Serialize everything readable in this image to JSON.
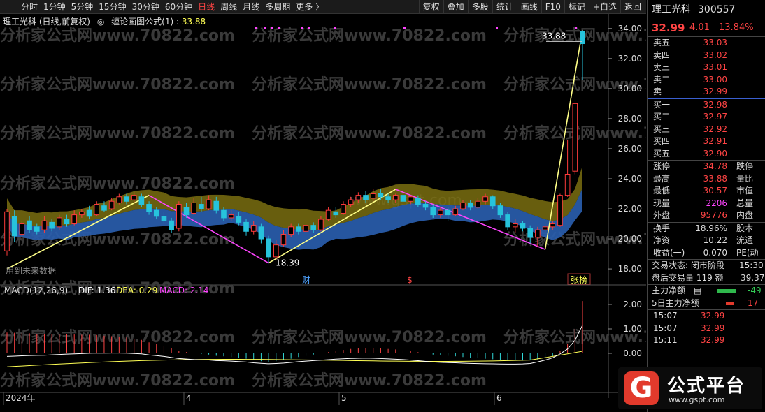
{
  "toolbar": {
    "periods": [
      "分时",
      "1分钟",
      "5分钟",
      "15分钟",
      "30分钟",
      "60分钟",
      "日线",
      "周线",
      "月线",
      "多周期",
      "更多 〉"
    ],
    "active_period": "日线",
    "tools": [
      "复权",
      "叠加",
      "多股",
      "统计",
      "画线",
      "F10",
      "标记",
      "+自选",
      "返回"
    ]
  },
  "main_chart": {
    "title": "理工光科 (日线,前复权)",
    "indicator_name": "缠论画图公式(1) :",
    "indicator_value": "33.88",
    "y_ticks": [
      "34.00",
      "32.00",
      "30.00",
      "28.00",
      "26.00",
      "24.00",
      "22.00",
      "20.00",
      "18.00"
    ],
    "high_label": "33.88",
    "low_label": "18.39",
    "future_label": "用到未来数据",
    "event_labels": [
      "财",
      "$",
      "张榜"
    ],
    "watermark": "分析家公式网www.70822.com",
    "watermark_center": "www.gspt.com"
  },
  "macd_chart": {
    "title": "MACD(12,26,9)",
    "dif": "DIF: 1.36",
    "dea": "DEA: 0.29",
    "macd": "MACD: 2.14",
    "y_ticks": [
      "2.00",
      "1.00",
      "0.00"
    ],
    "x_labels": [
      "2024年",
      "4",
      "5",
      "6"
    ]
  },
  "chart_data": {
    "type": "candlestick",
    "y_range": [
      17.4,
      34.5
    ],
    "candles": [
      {
        "o": 19.2,
        "c": 21.8,
        "h": 22.0,
        "l": 18.9
      },
      {
        "o": 21.5,
        "c": 20.2,
        "h": 21.9,
        "l": 19.8
      },
      {
        "o": 20.3,
        "c": 21.0,
        "h": 21.2,
        "l": 20.0
      },
      {
        "o": 21.2,
        "c": 20.6,
        "h": 21.5,
        "l": 20.4
      },
      {
        "o": 20.8,
        "c": 20.5,
        "h": 21.0,
        "l": 20.3
      },
      {
        "o": 20.6,
        "c": 21.2,
        "h": 21.5,
        "l": 20.4
      },
      {
        "o": 21.1,
        "c": 20.7,
        "h": 21.3,
        "l": 20.5
      },
      {
        "o": 20.8,
        "c": 21.4,
        "h": 21.6,
        "l": 20.6
      },
      {
        "o": 21.3,
        "c": 21.0,
        "h": 21.6,
        "l": 20.8
      },
      {
        "o": 21.0,
        "c": 21.6,
        "h": 21.9,
        "l": 20.9
      },
      {
        "o": 21.6,
        "c": 21.8,
        "h": 22.0,
        "l": 21.4
      },
      {
        "o": 21.9,
        "c": 21.5,
        "h": 22.2,
        "l": 21.3
      },
      {
        "o": 21.6,
        "c": 22.3,
        "h": 22.5,
        "l": 21.5
      },
      {
        "o": 22.2,
        "c": 21.9,
        "h": 22.5,
        "l": 21.8
      },
      {
        "o": 22.0,
        "c": 22.5,
        "h": 22.7,
        "l": 21.9
      },
      {
        "o": 22.4,
        "c": 22.8,
        "h": 23.0,
        "l": 22.3
      },
      {
        "o": 22.8,
        "c": 22.5,
        "h": 23.0,
        "l": 22.3
      },
      {
        "o": 22.6,
        "c": 22.9,
        "h": 23.1,
        "l": 22.4
      },
      {
        "o": 22.8,
        "c": 22.3,
        "h": 23.0,
        "l": 22.1
      },
      {
        "o": 22.3,
        "c": 21.8,
        "h": 22.5,
        "l": 21.6
      },
      {
        "o": 21.9,
        "c": 21.5,
        "h": 22.1,
        "l": 21.3
      },
      {
        "o": 21.5,
        "c": 21.2,
        "h": 21.8,
        "l": 21.0
      },
      {
        "o": 21.2,
        "c": 20.6,
        "h": 21.4,
        "l": 20.4
      },
      {
        "o": 20.7,
        "c": 22.3,
        "h": 22.5,
        "l": 20.5
      },
      {
        "o": 22.1,
        "c": 21.6,
        "h": 22.4,
        "l": 21.4
      },
      {
        "o": 21.7,
        "c": 22.4,
        "h": 22.7,
        "l": 21.6
      },
      {
        "o": 22.3,
        "c": 22.0,
        "h": 22.8,
        "l": 21.8
      },
      {
        "o": 22.0,
        "c": 22.6,
        "h": 22.9,
        "l": 21.9
      },
      {
        "o": 22.5,
        "c": 21.9,
        "h": 22.8,
        "l": 21.7
      },
      {
        "o": 21.9,
        "c": 21.4,
        "h": 22.1,
        "l": 21.2
      },
      {
        "o": 21.4,
        "c": 21.6,
        "h": 21.9,
        "l": 21.2
      },
      {
        "o": 21.5,
        "c": 21.1,
        "h": 21.8,
        "l": 20.9
      },
      {
        "o": 21.1,
        "c": 20.5,
        "h": 21.3,
        "l": 20.2
      },
      {
        "o": 20.5,
        "c": 20.9,
        "h": 21.2,
        "l": 20.3
      },
      {
        "o": 20.8,
        "c": 20.0,
        "h": 21.0,
        "l": 19.7
      },
      {
        "o": 20.0,
        "c": 18.8,
        "h": 20.2,
        "l": 18.39
      },
      {
        "o": 18.8,
        "c": 19.6,
        "h": 19.9,
        "l": 18.6
      },
      {
        "o": 19.6,
        "c": 20.3,
        "h": 20.6,
        "l": 19.5
      },
      {
        "o": 20.3,
        "c": 20.8,
        "h": 21.0,
        "l": 20.1
      },
      {
        "o": 20.8,
        "c": 20.5,
        "h": 21.0,
        "l": 20.3
      },
      {
        "o": 20.5,
        "c": 20.9,
        "h": 21.2,
        "l": 20.4
      },
      {
        "o": 20.9,
        "c": 20.6,
        "h": 21.1,
        "l": 20.4
      },
      {
        "o": 20.6,
        "c": 21.3,
        "h": 21.5,
        "l": 20.5
      },
      {
        "o": 21.3,
        "c": 21.9,
        "h": 22.1,
        "l": 21.2
      },
      {
        "o": 21.8,
        "c": 21.6,
        "h": 22.1,
        "l": 21.4
      },
      {
        "o": 21.7,
        "c": 22.3,
        "h": 22.5,
        "l": 21.6
      },
      {
        "o": 22.3,
        "c": 22.6,
        "h": 22.8,
        "l": 22.1
      },
      {
        "o": 22.6,
        "c": 22.9,
        "h": 23.1,
        "l": 22.4
      },
      {
        "o": 22.9,
        "c": 22.6,
        "h": 23.2,
        "l": 22.4
      },
      {
        "o": 22.7,
        "c": 23.0,
        "h": 23.3,
        "l": 22.5
      },
      {
        "o": 23.0,
        "c": 22.8,
        "h": 23.3,
        "l": 22.6
      },
      {
        "o": 22.8,
        "c": 22.6,
        "h": 23.0,
        "l": 22.4
      },
      {
        "o": 22.6,
        "c": 22.9,
        "h": 23.0,
        "l": 22.4
      },
      {
        "o": 22.9,
        "c": 22.5,
        "h": 23.0,
        "l": 22.3
      },
      {
        "o": 22.5,
        "c": 22.8,
        "h": 22.9,
        "l": 22.3
      },
      {
        "o": 22.7,
        "c": 22.3,
        "h": 22.9,
        "l": 22.1
      },
      {
        "o": 22.3,
        "c": 22.1,
        "h": 22.5,
        "l": 21.9
      },
      {
        "o": 22.1,
        "c": 21.6,
        "h": 22.3,
        "l": 21.4
      },
      {
        "o": 21.6,
        "c": 21.9,
        "h": 22.1,
        "l": 21.4
      },
      {
        "o": 21.9,
        "c": 21.6,
        "h": 22.1,
        "l": 21.2
      },
      {
        "o": 21.6,
        "c": 22.0,
        "h": 22.2,
        "l": 21.5
      },
      {
        "o": 22.0,
        "c": 22.4,
        "h": 22.6,
        "l": 21.9
      },
      {
        "o": 22.4,
        "c": 22.1,
        "h": 22.6,
        "l": 21.9
      },
      {
        "o": 22.1,
        "c": 22.5,
        "h": 22.7,
        "l": 22.0
      },
      {
        "o": 22.5,
        "c": 22.8,
        "h": 23.0,
        "l": 22.3
      },
      {
        "o": 22.8,
        "c": 22.2,
        "h": 22.9,
        "l": 22.0
      },
      {
        "o": 22.2,
        "c": 21.6,
        "h": 22.4,
        "l": 21.4
      },
      {
        "o": 21.6,
        "c": 20.8,
        "h": 21.8,
        "l": 20.6
      },
      {
        "o": 20.8,
        "c": 21.0,
        "h": 21.3,
        "l": 20.4
      },
      {
        "o": 21.0,
        "c": 20.7,
        "h": 21.2,
        "l": 20.5
      },
      {
        "o": 20.7,
        "c": 20.1,
        "h": 20.9,
        "l": 19.7
      },
      {
        "o": 20.1,
        "c": 20.6,
        "h": 20.8,
        "l": 19.5
      },
      {
        "o": 20.6,
        "c": 20.8,
        "h": 21.0,
        "l": 20.4
      },
      {
        "o": 20.8,
        "c": 21.0,
        "h": 21.2,
        "l": 20.6
      },
      {
        "o": 20.9,
        "c": 22.9,
        "h": 23.0,
        "l": 20.8
      },
      {
        "o": 22.9,
        "c": 24.3,
        "h": 26.6,
        "l": 22.8
      },
      {
        "o": 24.5,
        "c": 29.0,
        "h": 29.0,
        "l": 24.3
      },
      {
        "o": 33.8,
        "c": 32.99,
        "h": 33.88,
        "l": 30.57
      }
    ],
    "markers": [
      {
        "label": "high",
        "value": 33.88
      },
      {
        "label": "low",
        "value": 18.39
      }
    ],
    "macd_histogram": [
      0.85,
      0.84,
      0.83,
      0.82,
      0.8,
      0.78,
      0.78,
      0.78,
      0.78,
      0.77,
      0.76,
      0.76,
      0.75,
      0.72,
      0.7,
      0.68,
      0.65,
      0.6,
      0.55,
      0.45,
      0.38,
      0.3,
      0.2,
      0.1,
      0.05,
      0.0,
      -0.03,
      -0.05,
      -0.1,
      -0.12,
      -0.15,
      -0.18,
      -0.22,
      -0.28,
      -0.32,
      -0.35,
      -0.32,
      -0.28,
      -0.22,
      -0.15,
      -0.1,
      -0.05,
      0.0,
      0.05,
      0.1,
      0.14,
      0.18,
      0.2,
      0.22,
      0.22,
      0.2,
      0.18,
      0.16,
      0.14,
      0.1,
      0.05,
      0.0,
      -0.05,
      -0.08,
      -0.1,
      -0.12,
      -0.15,
      -0.18,
      -0.2,
      -0.22,
      -0.24,
      -0.26,
      -0.28,
      -0.3,
      -0.3,
      -0.28,
      -0.25,
      -0.2,
      -0.12,
      0.1,
      0.4,
      1.0,
      2.14
    ]
  },
  "quote": {
    "name": "理工光科",
    "code": "300557",
    "price": "32.99",
    "change": "4.01",
    "change_pct": "13.84%",
    "asks": [
      {
        "label": "卖五",
        "price": "33.03"
      },
      {
        "label": "卖四",
        "price": "33.02"
      },
      {
        "label": "卖三",
        "price": "33.01"
      },
      {
        "label": "卖二",
        "price": "33.00"
      },
      {
        "label": "卖一",
        "price": "32.99"
      }
    ],
    "bids": [
      {
        "label": "买一",
        "price": "32.98"
      },
      {
        "label": "买二",
        "price": "32.97"
      },
      {
        "label": "买三",
        "price": "32.92"
      },
      {
        "label": "买四",
        "price": "32.91"
      },
      {
        "label": "买五",
        "price": "32.90"
      }
    ],
    "stats": [
      {
        "label": "涨停",
        "value": "34.78",
        "label2": "跌停"
      },
      {
        "label": "最高",
        "value": "33.88",
        "label2": "量比"
      },
      {
        "label": "最低",
        "value": "30.57",
        "label2": "市值"
      },
      {
        "label": "现量",
        "value": "2206",
        "label2": "总量"
      },
      {
        "label": "外盘",
        "value": "95776",
        "label2": "内盘"
      }
    ],
    "stats2": [
      {
        "label": "换手",
        "value": "18.96%",
        "label2": "股本"
      },
      {
        "label": "净资",
        "value": "10.22",
        "label2": "流通"
      },
      {
        "label": "收益(一)",
        "value": "0.070",
        "label2": "PE(动"
      }
    ],
    "status_label": "交易状态: 闭市阶段",
    "status_time": "15:30",
    "after_hours": "盘后交易量 119 额",
    "after_hours_amount": "39.37",
    "main_net_label": "主力净额",
    "main_net_value": "-49",
    "main_net_5d_label": "5日主力净额",
    "main_net_5d_value": "17",
    "ticks": [
      {
        "time": "15:07",
        "price": "32.99"
      },
      {
        "time": "15:07",
        "price": "32.99"
      },
      {
        "time": "15:11",
        "price": "32.99"
      }
    ]
  },
  "logo": {
    "glyph": "G",
    "name": "公式平台",
    "url": "www.gspt.com"
  }
}
